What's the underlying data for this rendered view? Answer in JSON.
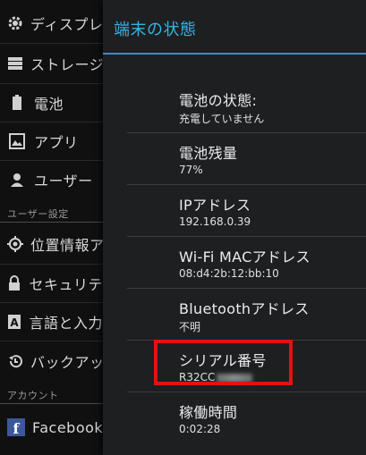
{
  "background_list": {
    "items": [
      {
        "label": "ディスプレ",
        "icon": "gear-icon"
      },
      {
        "label": "ストレージ",
        "icon": "storage-icon"
      },
      {
        "label": "電池",
        "icon": "battery-icon"
      },
      {
        "label": "アプリ",
        "icon": "apps-icon"
      },
      {
        "label": "ユーザー",
        "icon": "user-icon"
      }
    ],
    "section_user": "ユーザー設定",
    "user_items": [
      {
        "label": "位置情報ア",
        "icon": "location-icon"
      },
      {
        "label": "セキュリテ",
        "icon": "lock-icon"
      },
      {
        "label": "言語と入力",
        "icon": "keyboard-icon"
      },
      {
        "label": "バックアッ",
        "icon": "backup-icon"
      }
    ],
    "section_account": "アカウント",
    "account_items": [
      {
        "label": "Facebook",
        "icon": "facebook-icon"
      }
    ]
  },
  "panel": {
    "title": "端末の状態",
    "rows": [
      {
        "title": "電池の状態:",
        "value": "充電していません"
      },
      {
        "title": "電池残量",
        "value": "77%"
      },
      {
        "title": "IPアドレス",
        "value": "192.168.0.39"
      },
      {
        "title": "Wi-Fi MACアドレス",
        "value": "08:d4:2b:12:bb:10"
      },
      {
        "title": "Bluetoothアドレス",
        "value": "不明"
      },
      {
        "title": "シリアル番号",
        "value": "R32CC"
      },
      {
        "title": "稼働時間",
        "value": "0:02:28"
      }
    ]
  },
  "colors": {
    "accent": "#36b2e6",
    "highlight": "#e81010"
  }
}
